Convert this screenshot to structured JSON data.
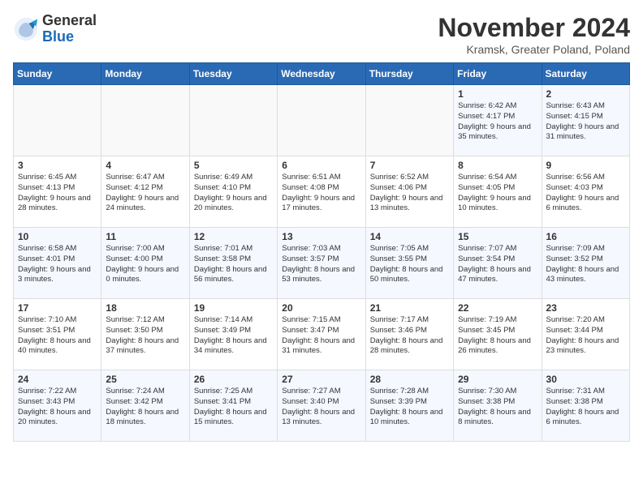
{
  "logo": {
    "general": "General",
    "blue": "Blue"
  },
  "title": "November 2024",
  "location": "Kramsk, Greater Poland, Poland",
  "headers": [
    "Sunday",
    "Monday",
    "Tuesday",
    "Wednesday",
    "Thursday",
    "Friday",
    "Saturday"
  ],
  "weeks": [
    [
      {
        "day": "",
        "info": ""
      },
      {
        "day": "",
        "info": ""
      },
      {
        "day": "",
        "info": ""
      },
      {
        "day": "",
        "info": ""
      },
      {
        "day": "",
        "info": ""
      },
      {
        "day": "1",
        "info": "Sunrise: 6:42 AM\nSunset: 4:17 PM\nDaylight: 9 hours and 35 minutes."
      },
      {
        "day": "2",
        "info": "Sunrise: 6:43 AM\nSunset: 4:15 PM\nDaylight: 9 hours and 31 minutes."
      }
    ],
    [
      {
        "day": "3",
        "info": "Sunrise: 6:45 AM\nSunset: 4:13 PM\nDaylight: 9 hours and 28 minutes."
      },
      {
        "day": "4",
        "info": "Sunrise: 6:47 AM\nSunset: 4:12 PM\nDaylight: 9 hours and 24 minutes."
      },
      {
        "day": "5",
        "info": "Sunrise: 6:49 AM\nSunset: 4:10 PM\nDaylight: 9 hours and 20 minutes."
      },
      {
        "day": "6",
        "info": "Sunrise: 6:51 AM\nSunset: 4:08 PM\nDaylight: 9 hours and 17 minutes."
      },
      {
        "day": "7",
        "info": "Sunrise: 6:52 AM\nSunset: 4:06 PM\nDaylight: 9 hours and 13 minutes."
      },
      {
        "day": "8",
        "info": "Sunrise: 6:54 AM\nSunset: 4:05 PM\nDaylight: 9 hours and 10 minutes."
      },
      {
        "day": "9",
        "info": "Sunrise: 6:56 AM\nSunset: 4:03 PM\nDaylight: 9 hours and 6 minutes."
      }
    ],
    [
      {
        "day": "10",
        "info": "Sunrise: 6:58 AM\nSunset: 4:01 PM\nDaylight: 9 hours and 3 minutes."
      },
      {
        "day": "11",
        "info": "Sunrise: 7:00 AM\nSunset: 4:00 PM\nDaylight: 9 hours and 0 minutes."
      },
      {
        "day": "12",
        "info": "Sunrise: 7:01 AM\nSunset: 3:58 PM\nDaylight: 8 hours and 56 minutes."
      },
      {
        "day": "13",
        "info": "Sunrise: 7:03 AM\nSunset: 3:57 PM\nDaylight: 8 hours and 53 minutes."
      },
      {
        "day": "14",
        "info": "Sunrise: 7:05 AM\nSunset: 3:55 PM\nDaylight: 8 hours and 50 minutes."
      },
      {
        "day": "15",
        "info": "Sunrise: 7:07 AM\nSunset: 3:54 PM\nDaylight: 8 hours and 47 minutes."
      },
      {
        "day": "16",
        "info": "Sunrise: 7:09 AM\nSunset: 3:52 PM\nDaylight: 8 hours and 43 minutes."
      }
    ],
    [
      {
        "day": "17",
        "info": "Sunrise: 7:10 AM\nSunset: 3:51 PM\nDaylight: 8 hours and 40 minutes."
      },
      {
        "day": "18",
        "info": "Sunrise: 7:12 AM\nSunset: 3:50 PM\nDaylight: 8 hours and 37 minutes."
      },
      {
        "day": "19",
        "info": "Sunrise: 7:14 AM\nSunset: 3:49 PM\nDaylight: 8 hours and 34 minutes."
      },
      {
        "day": "20",
        "info": "Sunrise: 7:15 AM\nSunset: 3:47 PM\nDaylight: 8 hours and 31 minutes."
      },
      {
        "day": "21",
        "info": "Sunrise: 7:17 AM\nSunset: 3:46 PM\nDaylight: 8 hours and 28 minutes."
      },
      {
        "day": "22",
        "info": "Sunrise: 7:19 AM\nSunset: 3:45 PM\nDaylight: 8 hours and 26 minutes."
      },
      {
        "day": "23",
        "info": "Sunrise: 7:20 AM\nSunset: 3:44 PM\nDaylight: 8 hours and 23 minutes."
      }
    ],
    [
      {
        "day": "24",
        "info": "Sunrise: 7:22 AM\nSunset: 3:43 PM\nDaylight: 8 hours and 20 minutes."
      },
      {
        "day": "25",
        "info": "Sunrise: 7:24 AM\nSunset: 3:42 PM\nDaylight: 8 hours and 18 minutes."
      },
      {
        "day": "26",
        "info": "Sunrise: 7:25 AM\nSunset: 3:41 PM\nDaylight: 8 hours and 15 minutes."
      },
      {
        "day": "27",
        "info": "Sunrise: 7:27 AM\nSunset: 3:40 PM\nDaylight: 8 hours and 13 minutes."
      },
      {
        "day": "28",
        "info": "Sunrise: 7:28 AM\nSunset: 3:39 PM\nDaylight: 8 hours and 10 minutes."
      },
      {
        "day": "29",
        "info": "Sunrise: 7:30 AM\nSunset: 3:38 PM\nDaylight: 8 hours and 8 minutes."
      },
      {
        "day": "30",
        "info": "Sunrise: 7:31 AM\nSunset: 3:38 PM\nDaylight: 8 hours and 6 minutes."
      }
    ]
  ]
}
